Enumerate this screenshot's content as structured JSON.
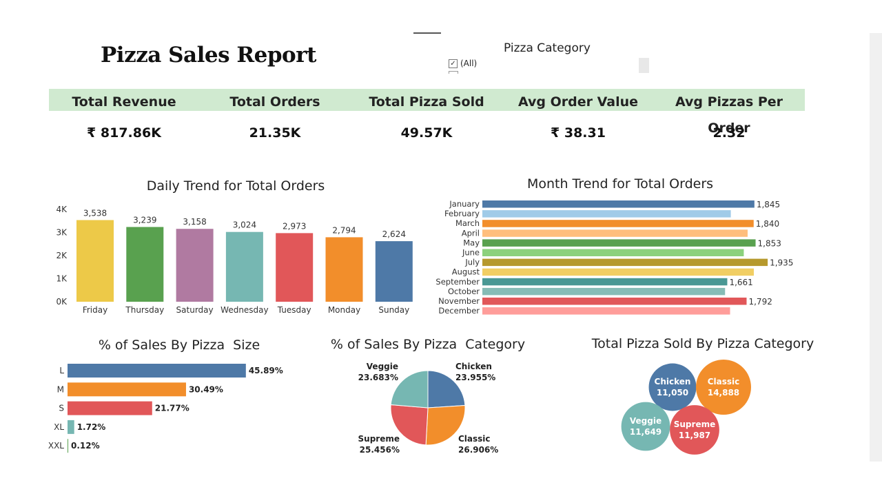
{
  "report": {
    "title": "Pizza Sales Report"
  },
  "filter": {
    "title": "Pizza Category",
    "option": "(All)",
    "checked": true
  },
  "kpis": [
    {
      "label": "Total Revenue",
      "value": "₹ 817.86K"
    },
    {
      "label": "Total Orders",
      "value": "21.35K"
    },
    {
      "label": "Total Pizza Sold",
      "value": "49.57K"
    },
    {
      "label": "Avg Order Value",
      "value": "₹ 38.31"
    },
    {
      "label": "Avg Pizzas Per Order",
      "value": "2.32"
    }
  ],
  "colors": {
    "kpi_band": "#d0ead0",
    "blue": "#4e79a7",
    "orange": "#f28e2b",
    "red": "#e15759",
    "teal": "#76b7b2",
    "green": "#59a14f"
  },
  "chart_data": [
    {
      "type": "bar",
      "title": "Daily Trend for Total Orders",
      "categories": [
        "Friday",
        "Thursday",
        "Saturday",
        "Wednesday",
        "Tuesday",
        "Monday",
        "Sunday"
      ],
      "values": [
        3538,
        3239,
        3158,
        3024,
        2973,
        2794,
        2624
      ],
      "value_labels": [
        "3,538",
        "3,239",
        "3,158",
        "3,024",
        "2,973",
        "2,794",
        "2,624"
      ],
      "colors": [
        "#edc948",
        "#59a14f",
        "#b07aa1",
        "#76b7b2",
        "#e15759",
        "#f28e2b",
        "#4e79a7"
      ],
      "yticks": [
        "0K",
        "1K",
        "2K",
        "3K",
        "4K"
      ],
      "ylim": [
        0,
        4000
      ]
    },
    {
      "type": "bar",
      "orientation": "horizontal",
      "title": "Month Trend for Total Orders",
      "categories": [
        "January",
        "February",
        "March",
        "April",
        "May",
        "June",
        "July",
        "August",
        "September",
        "October",
        "November",
        "December"
      ],
      "values": [
        1845,
        1685,
        1840,
        1799,
        1853,
        1773,
        1935,
        1841,
        1661,
        1646,
        1792,
        1680
      ],
      "value_labels": [
        "1,845",
        "",
        "1,840",
        "",
        "1,853",
        "",
        "1,935",
        "",
        "1,661",
        "",
        "1,792",
        ""
      ],
      "colors": [
        "#4e79a7",
        "#a0cbe8",
        "#f28e2b",
        "#ffbe7d",
        "#59a14f",
        "#8cd17d",
        "#b6992d",
        "#f1ce63",
        "#499894",
        "#86bcb6",
        "#e15759",
        "#ff9d9a"
      ],
      "xlim": [
        0,
        2000
      ]
    },
    {
      "type": "bar",
      "orientation": "horizontal",
      "title": "% of Sales By Pizza  Size",
      "categories": [
        "L",
        "M",
        "S",
        "XL",
        "XXL"
      ],
      "values": [
        45.89,
        30.49,
        21.77,
        1.72,
        0.12
      ],
      "value_labels": [
        "45.89%",
        "30.49%",
        "21.77%",
        "1.72%",
        "0.12%"
      ],
      "colors": [
        "#4e79a7",
        "#f28e2b",
        "#e15759",
        "#76b7b2",
        "#59a14f"
      ],
      "xlim": [
        0,
        50
      ]
    },
    {
      "type": "pie",
      "title": "% of Sales By Pizza  Category",
      "categories": [
        "Chicken",
        "Classic",
        "Supreme",
        "Veggie"
      ],
      "values": [
        23.955,
        26.906,
        25.456,
        23.683
      ],
      "value_labels": [
        "23.955%",
        "26.906%",
        "25.456%",
        "23.683%"
      ],
      "colors": [
        "#4e79a7",
        "#f28e2b",
        "#e15759",
        "#76b7b2"
      ]
    },
    {
      "type": "bubble",
      "title": "Total Pizza Sold By Pizza Category",
      "categories": [
        "Chicken",
        "Classic",
        "Veggie",
        "Supreme"
      ],
      "values": [
        11050,
        14888,
        11649,
        11987
      ],
      "value_labels": [
        "11,050",
        "14,888",
        "11,649",
        "11,987"
      ],
      "colors": [
        "#4e79a7",
        "#f28e2b",
        "#76b7b2",
        "#e15759"
      ]
    }
  ]
}
